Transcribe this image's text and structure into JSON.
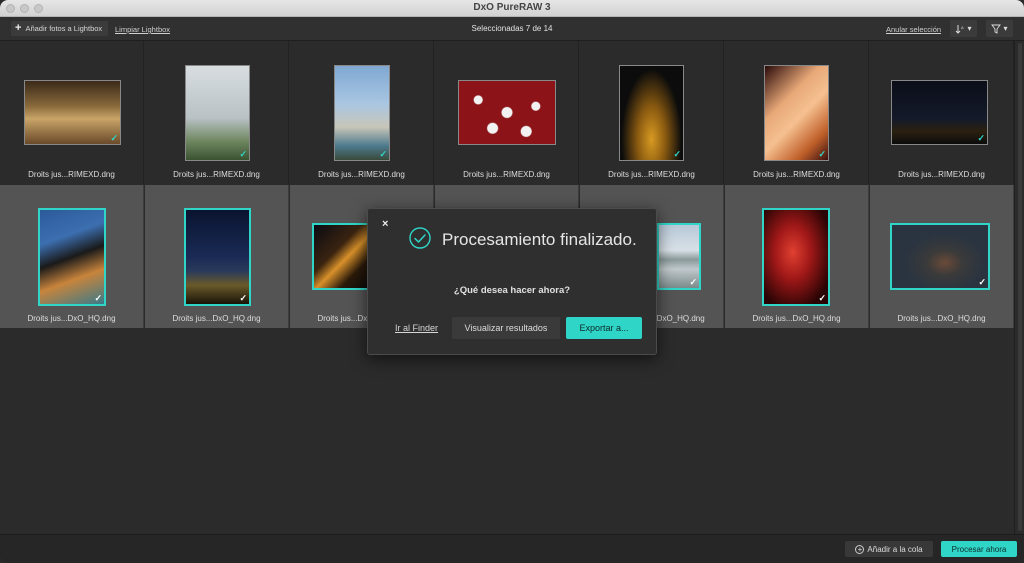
{
  "window": {
    "title": "DxO PureRAW 3"
  },
  "toolbar": {
    "add_label": "Añadir fotos a Lightbox",
    "clear_label": "Limpiar Lightbox",
    "selection_text": "Seleccionadas 7 de 14",
    "deselect_label": "Anular selección",
    "sort_icon": "sort-icon",
    "filter_icon": "filter-icon"
  },
  "photos": [
    {
      "name": "Droits jus...RIMEXD.dng",
      "selected": false,
      "checked": true
    },
    {
      "name": "Droits jus...RIMEXD.dng",
      "selected": false,
      "checked": true
    },
    {
      "name": "Droits jus...RIMEXD.dng",
      "selected": false,
      "checked": true
    },
    {
      "name": "Droits jus...RIMEXD.dng",
      "selected": false,
      "checked": false
    },
    {
      "name": "Droits jus...RIMEXD.dng",
      "selected": false,
      "checked": true
    },
    {
      "name": "Droits jus...RIMEXD.dng",
      "selected": false,
      "checked": true
    },
    {
      "name": "Droits jus...RIMEXD.dng",
      "selected": false,
      "checked": true
    },
    {
      "name": "Droits jus...DxO_HQ.dng",
      "selected": true,
      "checked": true
    },
    {
      "name": "Droits jus...DxO_HQ.dng",
      "selected": true,
      "checked": true
    },
    {
      "name": "Droits jus...DxO_HQ.dng",
      "selected": true,
      "checked": true
    },
    {
      "name": "",
      "selected": true,
      "checked": false
    },
    {
      "name": "...DxO_HQ.dng",
      "selected": true,
      "checked": true
    },
    {
      "name": "Droits jus...DxO_HQ.dng",
      "selected": true,
      "checked": true
    },
    {
      "name": "Droits jus...DxO_HQ.dng",
      "selected": true,
      "checked": true
    }
  ],
  "bottombar": {
    "queue_label": "Añadir a la cola",
    "process_label": "Procesar ahora"
  },
  "dialog": {
    "title": "Procesamiento finalizado.",
    "question": "¿Qué desea hacer ahora?",
    "finder_label": "Ir al Finder",
    "view_label": "Visualizar resultados",
    "export_label": "Exportar a..."
  },
  "colors": {
    "accent": "#2fd6c8",
    "selected_cell": "#545454",
    "background": "#2b2b2b"
  }
}
